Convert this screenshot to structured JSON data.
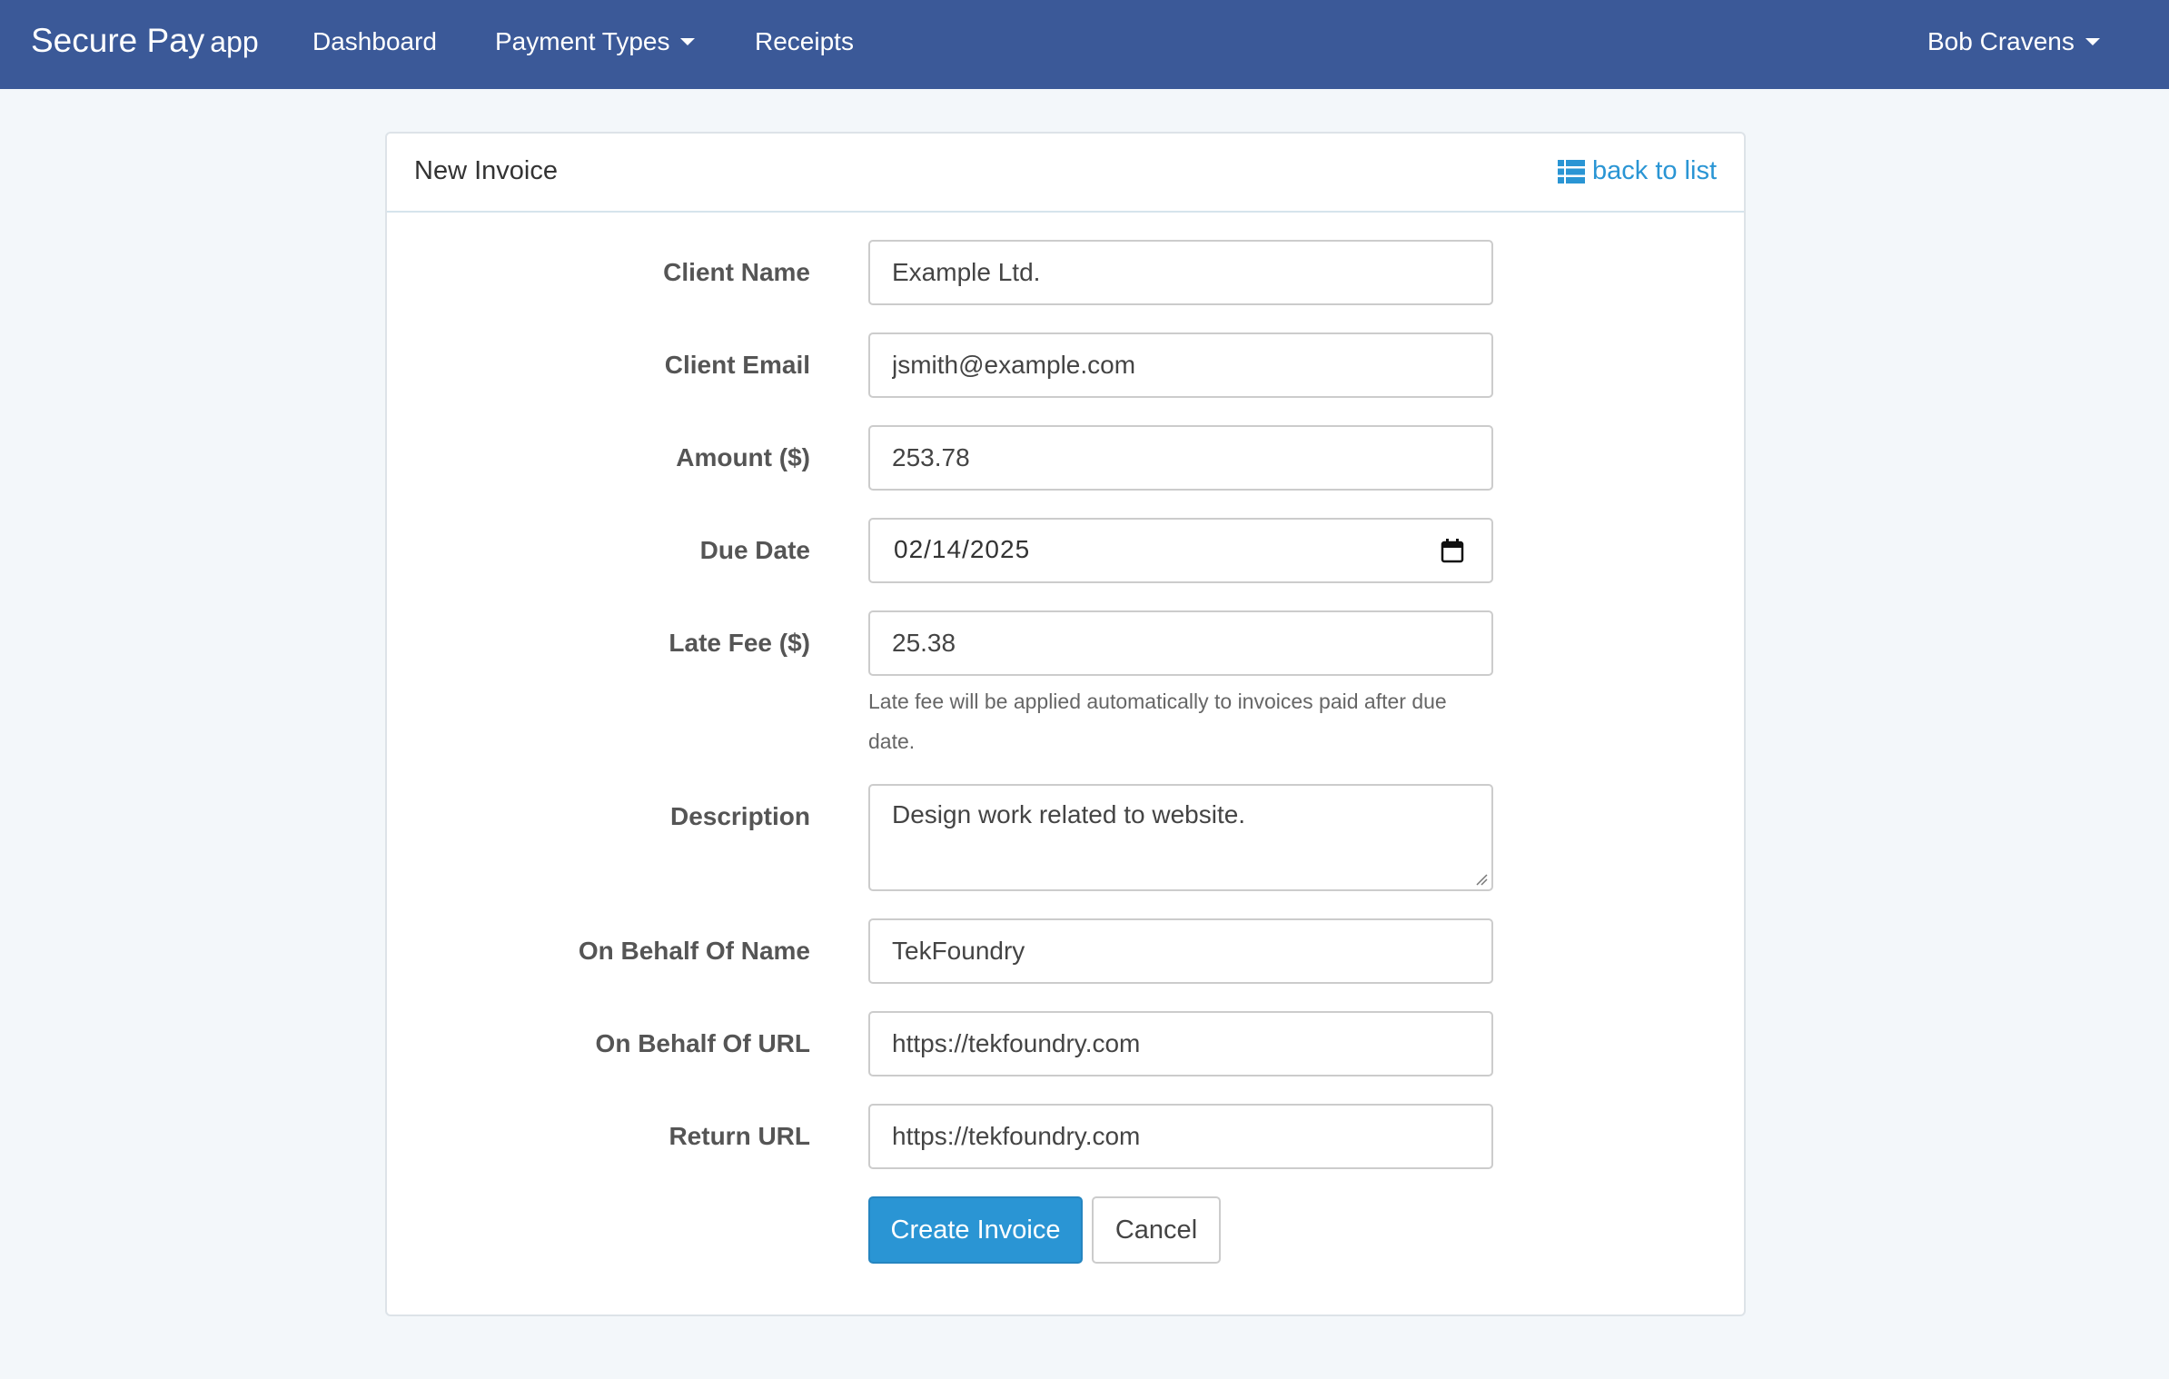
{
  "navbar": {
    "brand": "Secure Pay",
    "brand_suffix": "app",
    "links": [
      {
        "label": "Dashboard"
      },
      {
        "label": "Payment Types"
      },
      {
        "label": "Receipts"
      }
    ],
    "user": "Bob Cravens",
    "color": "#3b5998"
  },
  "panel": {
    "title": "New Invoice",
    "back_link": "back to list",
    "back_icon": "list-icon",
    "link_color": "#2a95d4"
  },
  "form": {
    "client_name": {
      "label": "Client Name",
      "value": "Example Ltd."
    },
    "client_email": {
      "label": "Client Email",
      "value": "jsmith@example.com"
    },
    "amount": {
      "label": "Amount ($)",
      "value": "253.78"
    },
    "due_date": {
      "label": "Due Date",
      "value": "02/14/2025"
    },
    "late_fee": {
      "label": "Late Fee ($)",
      "value": "25.38",
      "help": "Late fee will be applied automatically to invoices paid after due date."
    },
    "description": {
      "label": "Description",
      "value": "Design work related to website."
    },
    "on_behalf_name": {
      "label": "On Behalf Of Name",
      "value": "TekFoundry"
    },
    "on_behalf_url": {
      "label": "On Behalf Of URL",
      "value": "https://tekfoundry.com"
    },
    "return_url": {
      "label": "Return URL",
      "value": "https://tekfoundry.com"
    },
    "submit_label": "Create Invoice",
    "cancel_label": "Cancel"
  }
}
